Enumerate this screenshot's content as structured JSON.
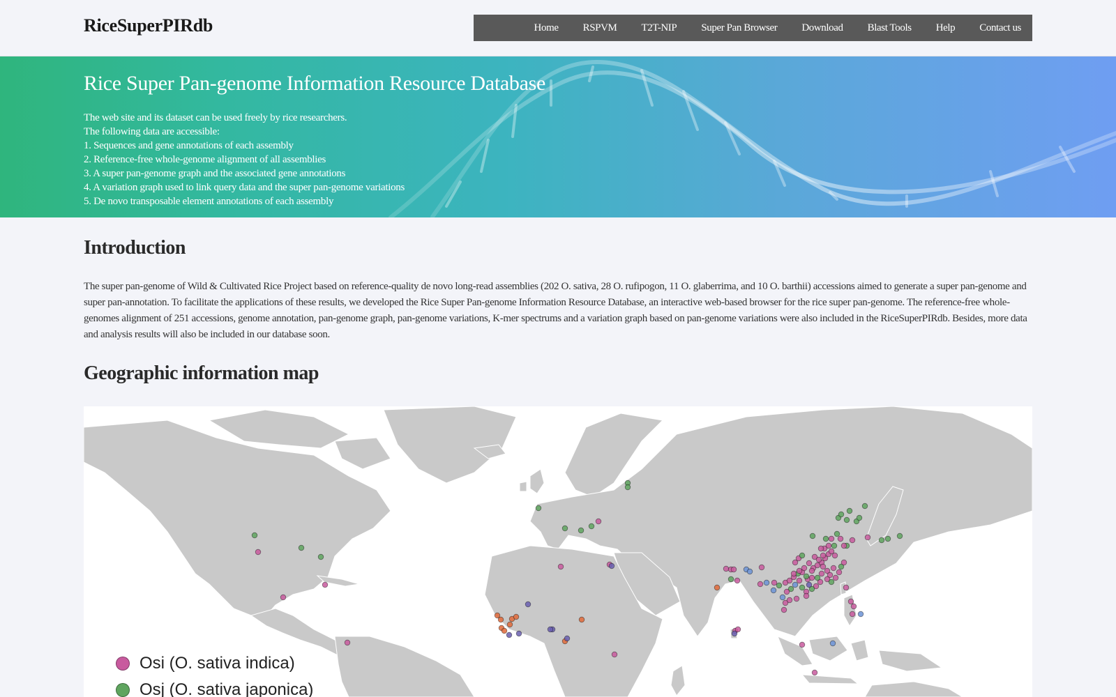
{
  "header": {
    "brand": "RiceSuperPIRdb",
    "nav": [
      "Home",
      "RSPVM",
      "T2T-NIP",
      "Super Pan Browser",
      "Download",
      "Blast Tools",
      "Help",
      "Contact us"
    ]
  },
  "banner": {
    "title": "Rice Super Pan-genome Information Resource Database",
    "lines": [
      "The web site and its dataset can be used freely by rice researchers.",
      "The following data are accessible:",
      "1. Sequences and gene annotations of each assembly",
      "2. Reference-free whole-genome alignment of all assemblies",
      "3. A super pan-genome graph and the associated gene annotations",
      "4. A variation graph used to link query data and the super pan-genome variations",
      "5. De novo transposable element annotations of each assembly"
    ]
  },
  "introduction": {
    "heading": "Introduction",
    "text": "The super pan-genome of Wild & Cultivated Rice Project based on reference-quality de novo long-read assemblies (202 O. sativa, 28 O. rufipogon, 11 O. glaberrima, and 10 O. barthii) accessions aimed to generate a super pan-genome and super pan-annotation. To facilitate the applications of these results, we developed the Rice Super Pan-genome Information Resource Database, an interactive web-based browser for the rice super pan-genome. The reference-free whole-genomes alignment of 251 accessions, genome annotation, pan-genome graph, pan-genome variations, K-mer  spectrums and a variation graph based on pan-genome variations were also included in the RiceSuperPIRdb. Besides, more data and analysis results will also be included in our database soon."
  },
  "geo": {
    "heading": "Geographic information map",
    "legend": [
      {
        "label": "Osi (O. sativa indica)",
        "color": "#c85a9e"
      },
      {
        "label": "Osj (O. sativa japonica)",
        "color": "#5fa55f"
      }
    ],
    "colors": {
      "osi": "#c85a9e",
      "osj": "#5fa55f",
      "blue": "#6c93d6",
      "orange": "#e06a3a",
      "purple": "#6a5fb0",
      "land": "#c9c9c9"
    }
  }
}
